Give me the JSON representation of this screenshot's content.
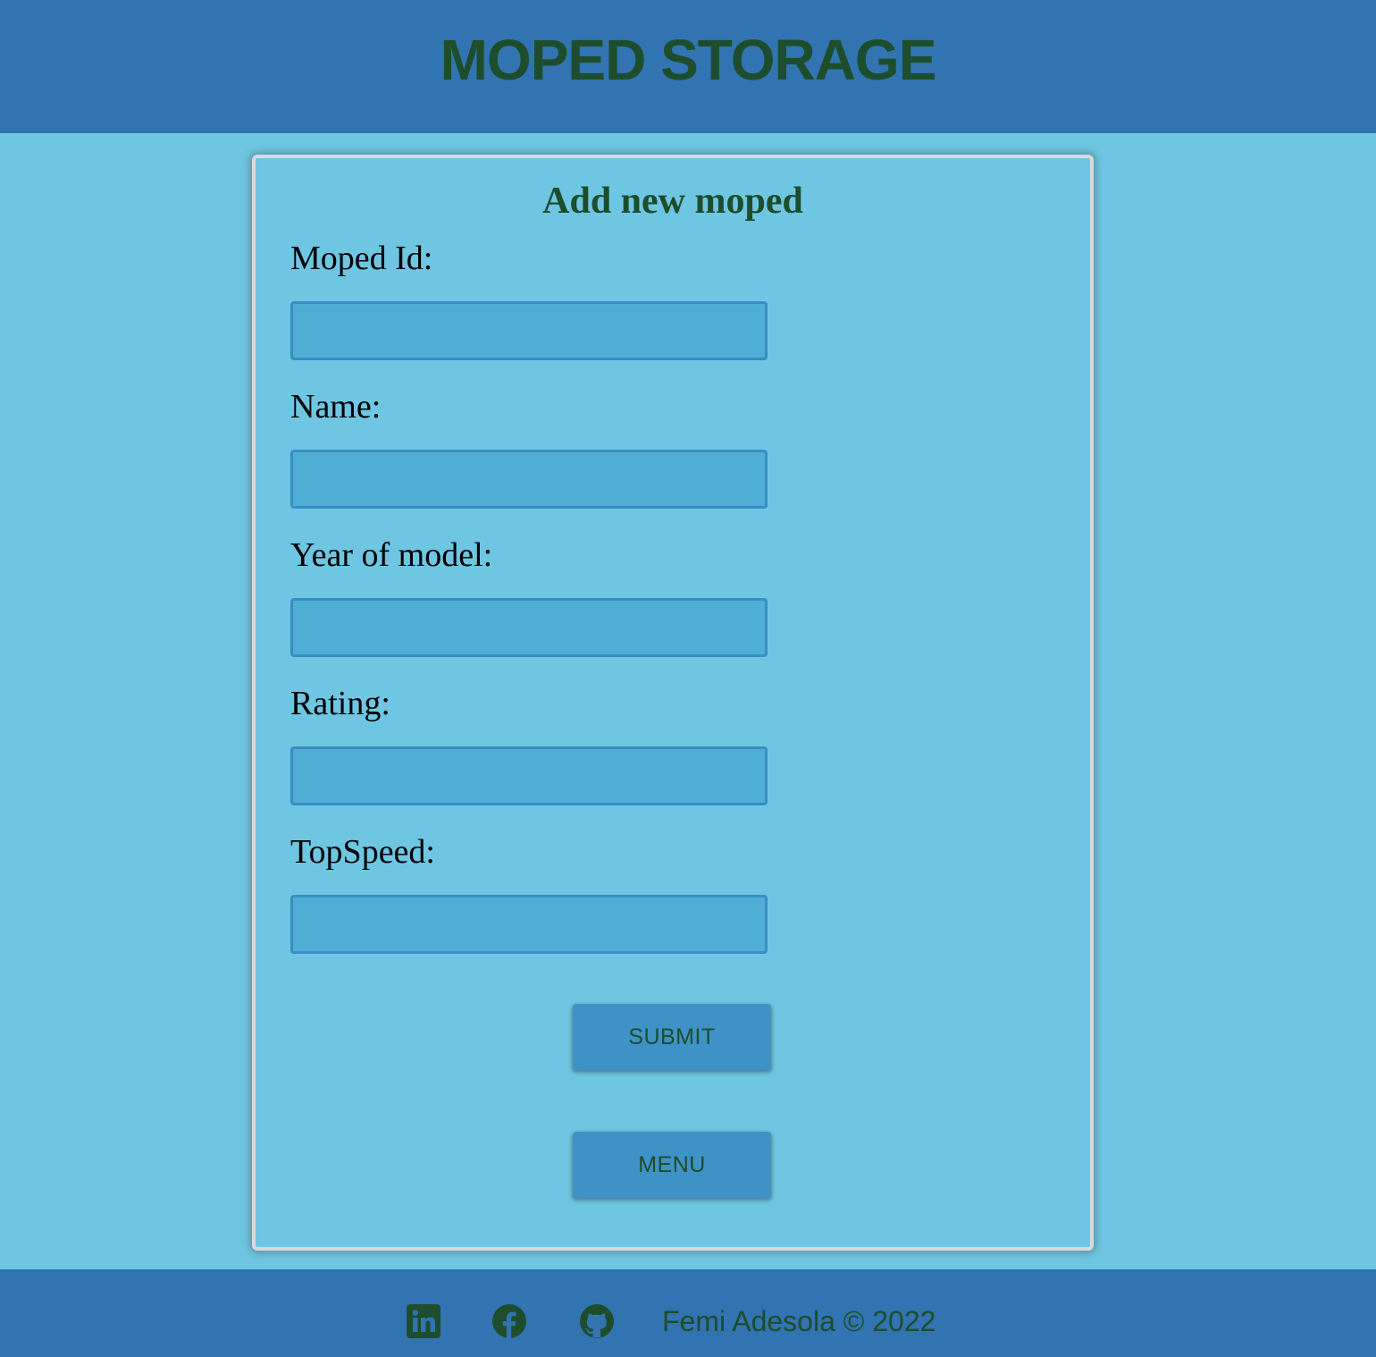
{
  "header": {
    "title": "MOPED STORAGE"
  },
  "form": {
    "title": "Add new moped",
    "fields": [
      {
        "label": "Moped Id:",
        "value": ""
      },
      {
        "label": "Name:",
        "value": ""
      },
      {
        "label": "Year of model:",
        "value": ""
      },
      {
        "label": "Rating:",
        "value": ""
      },
      {
        "label": "TopSpeed:",
        "value": ""
      }
    ],
    "submit_label": "SUBMIT",
    "menu_label": "MENU"
  },
  "footer": {
    "icons": [
      "linkedin-icon",
      "facebook-icon",
      "github-icon"
    ],
    "copyright": "Femi Adesola © 2022"
  },
  "colors": {
    "header_bg": "#3174b1",
    "page_bg": "#6fc6e2",
    "title_text": "#1d4d2c",
    "input_bg": "#4faed4",
    "button_bg": "#3f92c6"
  }
}
